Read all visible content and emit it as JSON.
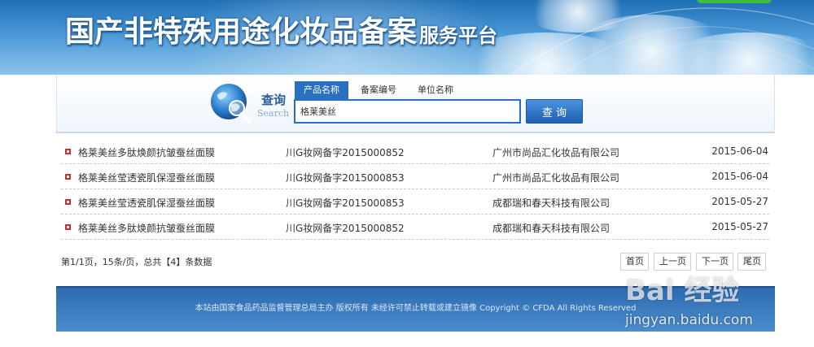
{
  "header": {
    "title": "国产非特殊用途化妆品备案",
    "subtitle": "服务平台"
  },
  "search": {
    "label": "查询",
    "label_en": "Search",
    "tabs": [
      {
        "label": "产品名称",
        "active": true
      },
      {
        "label": "备案编号",
        "active": false
      },
      {
        "label": "单位名称",
        "active": false
      }
    ],
    "input_value": "格莱美丝",
    "button_label": "查 询"
  },
  "results": [
    {
      "name": "格莱美丝多肽焕颜抗皱蚕丝面膜",
      "reg": "川G妆网备字2015000852",
      "company": "广州市尚品汇化妆品有限公司",
      "date": "2015-06-04"
    },
    {
      "name": "格莱美丝莹透瓷肌保湿蚕丝面膜",
      "reg": "川G妆网备字2015000853",
      "company": "广州市尚品汇化妆品有限公司",
      "date": "2015-06-04"
    },
    {
      "name": "格莱美丝莹透瓷肌保湿蚕丝面膜",
      "reg": "川G妆网备字2015000853",
      "company": "成都瑞和春天科技有限公司",
      "date": "2015-05-27"
    },
    {
      "name": "格莱美丝多肽焕颜抗皱蚕丝面膜",
      "reg": "川G妆网备字2015000852",
      "company": "成都瑞和春天科技有限公司",
      "date": "2015-05-27"
    }
  ],
  "pager": {
    "info": "第1/1页，15条/页，总共【4】条数据",
    "first": "首页",
    "prev": "上一页",
    "next": "下一页",
    "last": "尾页"
  },
  "footer": {
    "text": "本站由国家食品药品监督管理总局主办 版权所有 未经许可禁止转载或建立镜像 Copyright © CFDA All Rights Reserved"
  },
  "watermark": {
    "brand": "Bai 经验",
    "url": "jingyan.baidu.com"
  },
  "colors": {
    "accent": "#2a6fc0",
    "banner": "#4a98d6",
    "bullet": "#c9302c"
  }
}
